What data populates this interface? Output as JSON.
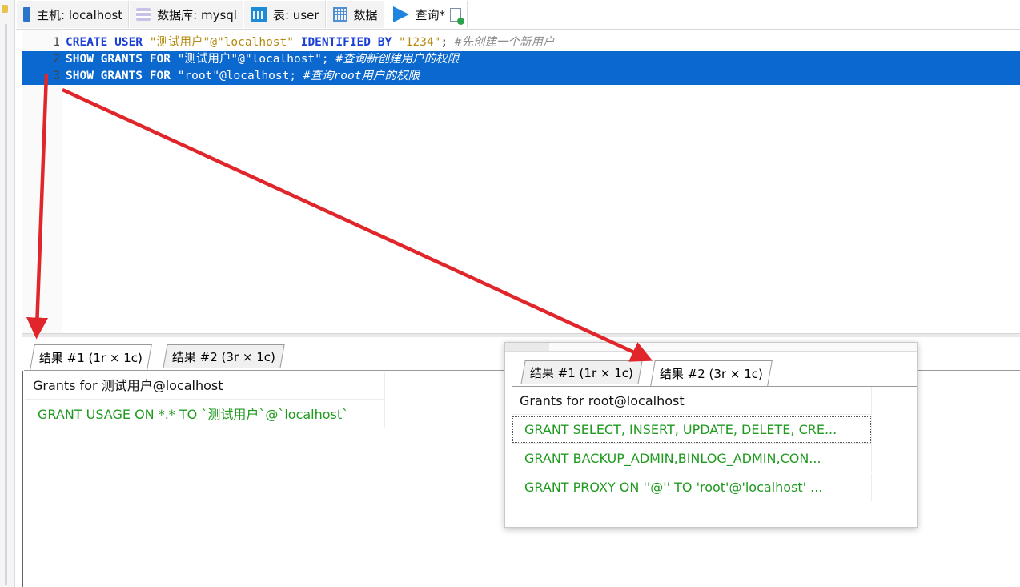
{
  "toolbar": {
    "tabs": [
      {
        "label": "主机: localhost",
        "icon": "host-icon"
      },
      {
        "label": "数据库: mysql",
        "icon": "database-icon"
      },
      {
        "label": "表: user",
        "icon": "table-icon"
      },
      {
        "label": "数据",
        "icon": "data-grid-icon"
      },
      {
        "label": "查询*",
        "icon": "play-icon"
      },
      {
        "label": "",
        "icon": "new-query-icon"
      }
    ]
  },
  "editor": {
    "lines": [
      {
        "num": "1",
        "tokens": [
          {
            "t": "CREATE USER ",
            "c": "kw"
          },
          {
            "t": "\"测试用户\"@\"localhost\" ",
            "c": "str"
          },
          {
            "t": "IDENTIFIED BY ",
            "c": "kw"
          },
          {
            "t": "\"1234\"",
            "c": "str"
          },
          {
            "t": "; ",
            "c": "plain"
          },
          {
            "t": "#先创建一个新用户",
            "c": "cmt"
          }
        ],
        "selected": false
      },
      {
        "num": "2",
        "tokens": [
          {
            "t": "SHOW GRANTS FOR ",
            "c": "kw"
          },
          {
            "t": "\"测试用户\"@\"localhost\"",
            "c": "str"
          },
          {
            "t": "; ",
            "c": "plain"
          },
          {
            "t": "#查询新创建用户的权限",
            "c": "cmt"
          }
        ],
        "selected": true
      },
      {
        "num": "3",
        "tokens": [
          {
            "t": "SHOW GRANTS FOR ",
            "c": "kw"
          },
          {
            "t": "\"root\"@localhost",
            "c": "str"
          },
          {
            "t": "; ",
            "c": "plain"
          },
          {
            "t": "#查询root用户的权限",
            "c": "cmt"
          }
        ],
        "selected": true
      }
    ]
  },
  "results": {
    "tabs": [
      "结果 #1 (1r × 1c)",
      "结果 #2 (3r × 1c)"
    ],
    "active_tab": 0,
    "header": "Grants for 测试用户@localhost",
    "rows": [
      "GRANT USAGE ON *.* TO `测试用户`@`localhost`"
    ]
  },
  "popup": {
    "tabs": [
      "结果 #1 (1r × 1c)",
      "结果 #2 (3r × 1c)"
    ],
    "active_tab": 1,
    "header": "Grants for root@localhost",
    "rows": [
      "GRANT SELECT, INSERT, UPDATE, DELETE, CRE...",
      "GRANT BACKUP_ADMIN,BINLOG_ADMIN,CON...",
      "GRANT PROXY ON ''@'' TO 'root'@'localhost' ..."
    ]
  },
  "colors": {
    "keyword": "#1b3fd6",
    "string": "#b58a10",
    "comment": "#8c8c8c",
    "selection": "#0b68cf",
    "grant_text": "#1f9a1f",
    "arrow": "#e0262b"
  }
}
